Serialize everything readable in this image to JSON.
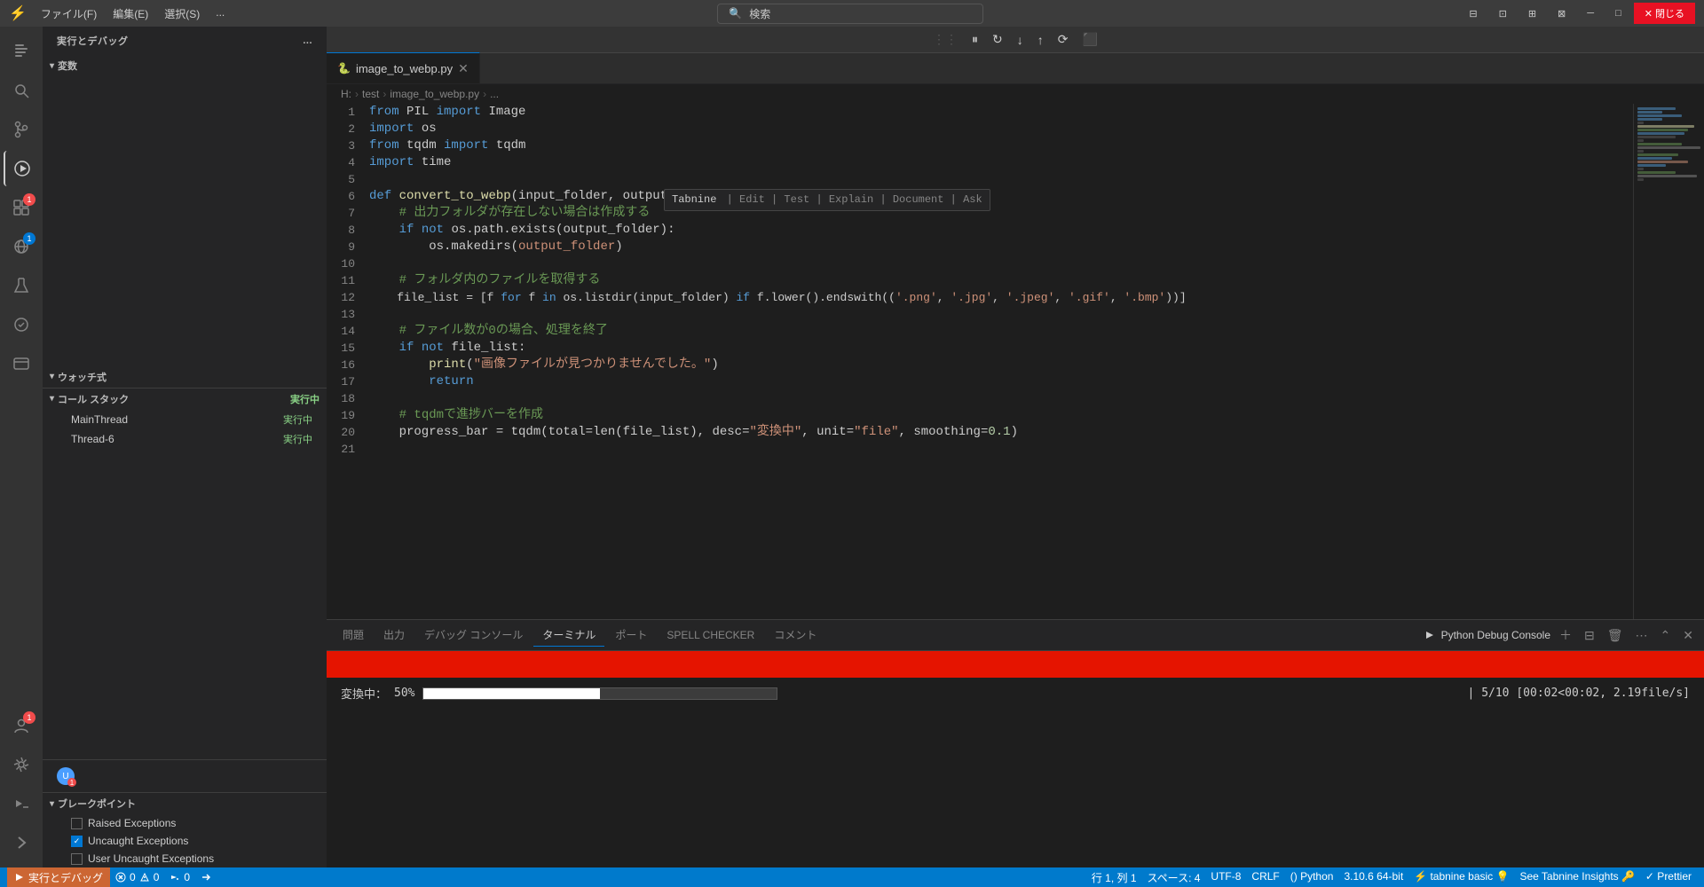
{
  "titleBar": {
    "logo": "VS",
    "menus": [
      "ファイル(F)",
      "編集(E)",
      "選択(S)",
      "..."
    ],
    "searchPlaceholder": "検索",
    "windowControls": [
      "─",
      "□",
      "✕"
    ]
  },
  "activityBar": {
    "icons": [
      {
        "name": "explorer-icon",
        "symbol": "⧉",
        "active": false
      },
      {
        "name": "search-icon",
        "symbol": "🔍",
        "active": false
      },
      {
        "name": "source-control-icon",
        "symbol": "⎇",
        "active": false
      },
      {
        "name": "run-debug-icon",
        "symbol": "▶",
        "active": true
      },
      {
        "name": "extensions-icon",
        "symbol": "⊞",
        "active": false,
        "badge": "1",
        "badgeType": "error"
      },
      {
        "name": "remote-explorer-icon",
        "symbol": "⬡",
        "active": false,
        "badge": "1"
      },
      {
        "name": "testing-icon",
        "symbol": "⚗",
        "active": false
      },
      {
        "name": "copilot-icon",
        "symbol": "✓",
        "active": false
      },
      {
        "name": "extensions2-icon",
        "symbol": "◫",
        "active": false
      }
    ],
    "bottomIcons": [
      {
        "name": "account-icon",
        "symbol": "👤",
        "badge": "1"
      },
      {
        "name": "settings-icon",
        "symbol": "⚙"
      },
      {
        "name": "debug-icon2",
        "symbol": "⚡"
      },
      {
        "name": "arrow-icon",
        "symbol": "→"
      }
    ]
  },
  "sidebar": {
    "header": "実行とデバッグ",
    "headerBtn": "...",
    "variablesSection": {
      "title": "変数",
      "collapsed": true
    },
    "watchSection": {
      "title": "ウォッチ式",
      "collapsed": true
    },
    "callStackSection": {
      "title": "コール スタック",
      "items": [
        {
          "name": "MainThread",
          "status": "実行中"
        },
        {
          "name": "Thread-6",
          "status": "実行中"
        }
      ]
    },
    "breakpointsSection": {
      "title": "ブレークポイント",
      "items": [
        {
          "label": "Raised Exceptions",
          "checked": false
        },
        {
          "label": "Uncaught Exceptions",
          "checked": true
        },
        {
          "label": "User Uncaught Exceptions",
          "checked": false
        }
      ]
    }
  },
  "editor": {
    "tab": {
      "filename": "image_to_webp.py",
      "icon": "🐍",
      "modified": false
    },
    "breadcrumb": [
      "H:",
      "test",
      "image_to_webp.py",
      "..."
    ],
    "lines": [
      {
        "num": 1,
        "code": "from PIL import Image",
        "tokens": [
          {
            "t": "kw",
            "v": "from"
          },
          {
            "t": "op",
            "v": " PIL "
          },
          {
            "t": "kw",
            "v": "import"
          },
          {
            "t": "op",
            "v": " Image"
          }
        ]
      },
      {
        "num": 2,
        "code": "import os",
        "tokens": [
          {
            "t": "kw",
            "v": "import"
          },
          {
            "t": "op",
            "v": " os"
          }
        ]
      },
      {
        "num": 3,
        "code": "from tqdm import tqdm",
        "tokens": [
          {
            "t": "kw",
            "v": "from"
          },
          {
            "t": "op",
            "v": " tqdm "
          },
          {
            "t": "kw",
            "v": "import"
          },
          {
            "t": "op",
            "v": " tqdm"
          }
        ]
      },
      {
        "num": 4,
        "code": "import time",
        "tokens": [
          {
            "t": "kw",
            "v": "import"
          },
          {
            "t": "op",
            "v": " time"
          }
        ]
      },
      {
        "num": 5,
        "code": "",
        "tokens": []
      },
      {
        "num": 6,
        "code": "def convert_to_webp(input_folder, output_folder):",
        "tokens": [
          {
            "t": "kw",
            "v": "def"
          },
          {
            "t": "op",
            "v": " "
          },
          {
            "t": "fn",
            "v": "convert_to_webp"
          },
          {
            "t": "op",
            "v": "(input_folder, output_folder):"
          }
        ]
      },
      {
        "num": 7,
        "code": "    # 出力フォルダが存在しない場合は作成する",
        "tokens": [
          {
            "t": "cm",
            "v": "    # 出力フォルダが存在しない場合は作成する"
          }
        ]
      },
      {
        "num": 8,
        "code": "    if not os.path.exists(output_folder):",
        "tokens": [
          {
            "t": "op",
            "v": "    "
          },
          {
            "t": "kw",
            "v": "if"
          },
          {
            "t": "op",
            "v": " "
          },
          {
            "t": "kw",
            "v": "not"
          },
          {
            "t": "op",
            "v": " os.path.exists(output_folder):"
          }
        ]
      },
      {
        "num": 9,
        "code": "        os.makedirs(output_folder)",
        "tokens": [
          {
            "t": "op",
            "v": "        os.makedirs(output_folder)"
          }
        ]
      },
      {
        "num": 10,
        "code": "",
        "tokens": []
      },
      {
        "num": 11,
        "code": "    # フォルダ内のファイルを取得する",
        "tokens": [
          {
            "t": "cm",
            "v": "    # フォルダ内のファイルを取得する"
          }
        ]
      },
      {
        "num": 12,
        "code": "    file_list = [f for f in os.listdir(input_folder) if f.lower().endswith(('.png', '.jpg', '.jpeg', '.gif', '.bmp'))]",
        "tokens": [
          {
            "t": "op",
            "v": "    file_list = [f "
          },
          {
            "t": "kw",
            "v": "for"
          },
          {
            "t": "op",
            "v": " f "
          },
          {
            "t": "kw",
            "v": "in"
          },
          {
            "t": "op",
            "v": " os.listdir(input_folder) "
          },
          {
            "t": "kw",
            "v": "if"
          },
          {
            "t": "op",
            "v": " f.lower().endswith(("
          },
          {
            "t": "str",
            "v": "'.png'"
          },
          {
            "t": "op",
            "v": ", "
          },
          {
            "t": "str",
            "v": "'.jpg'"
          },
          {
            "t": "op",
            "v": ", "
          },
          {
            "t": "str",
            "v": "'.jpeg'"
          },
          {
            "t": "op",
            "v": ", "
          },
          {
            "t": "str",
            "v": "'.gif'"
          },
          {
            "t": "op",
            "v": ", "
          },
          {
            "t": "str",
            "v": "'.bmp'"
          },
          {
            "t": "op",
            "v": "))]​"
          }
        ]
      },
      {
        "num": 13,
        "code": "",
        "tokens": []
      },
      {
        "num": 14,
        "code": "    # ファイル数が0の場合、処理を終了",
        "tokens": [
          {
            "t": "cm",
            "v": "    # ファイル数が0の場合、処理を終了"
          }
        ]
      },
      {
        "num": 15,
        "code": "    if not file_list:",
        "tokens": [
          {
            "t": "op",
            "v": "    "
          },
          {
            "t": "kw",
            "v": "if"
          },
          {
            "t": "op",
            "v": " "
          },
          {
            "t": "kw",
            "v": "not"
          },
          {
            "t": "op",
            "v": " file_list:"
          }
        ]
      },
      {
        "num": 16,
        "code": "        print(\"画像ファイルが見つかりませんでした。\")",
        "tokens": [
          {
            "t": "op",
            "v": "        "
          },
          {
            "t": "fn",
            "v": "print"
          },
          {
            "t": "op",
            "v": "("
          },
          {
            "t": "str",
            "v": "\"画像ファイルが見つかりませんでした。\""
          },
          {
            "t": "op",
            "v": ")"
          }
        ]
      },
      {
        "num": 17,
        "code": "        return",
        "tokens": [
          {
            "t": "op",
            "v": "        "
          },
          {
            "t": "kw",
            "v": "return"
          }
        ]
      },
      {
        "num": 18,
        "code": "",
        "tokens": []
      },
      {
        "num": 19,
        "code": "    # tqdmで進捗バーを作成",
        "tokens": [
          {
            "t": "cm",
            "v": "    # tqdmで進捗バーを作成"
          }
        ]
      },
      {
        "num": 20,
        "code": "    progress_bar = tqdm(total=len(file_list), desc=\"変換中\", unit=\"file\", smoothing=0.1)",
        "tokens": [
          {
            "t": "op",
            "v": "    progress_bar = tqdm(total=len(file_list), desc="
          },
          {
            "t": "str",
            "v": "\"変換中\""
          },
          {
            "t": "op",
            "v": ", unit="
          },
          {
            "t": "str",
            "v": "\"file\""
          },
          {
            "t": "op",
            "v": ", smoothing="
          },
          {
            "t": "num",
            "v": "0.1"
          },
          {
            "t": "op",
            "v": ")"
          }
        ]
      },
      {
        "num": 21,
        "code": "",
        "tokens": []
      }
    ],
    "tabnine": {
      "label": "Tabnine",
      "actions": [
        "Edit",
        "Test",
        "Explain",
        "Document",
        "Ask"
      ]
    }
  },
  "panel": {
    "tabs": [
      {
        "label": "問題",
        "active": false
      },
      {
        "label": "出力",
        "active": false
      },
      {
        "label": "デバッグ コンソール",
        "active": false
      },
      {
        "label": "ターミナル",
        "active": true
      },
      {
        "label": "ポート",
        "active": false
      },
      {
        "label": "SPELL CHECKER",
        "active": false
      },
      {
        "label": "コメント",
        "active": false
      }
    ],
    "pythonDebugConsole": "Python Debug Console",
    "terminal": {
      "progressLabel": "変換中：",
      "progressPercent": "50%",
      "progressStats": "| 5/10 [00:02<00:02,  2.19file/s]"
    }
  },
  "statusBar": {
    "left": [
      {
        "label": "⚡ 実行とデバッグ",
        "type": "debug"
      },
      {
        "icon": "⚠",
        "errors": "0",
        "warnings": "0"
      },
      {
        "icon": "⚡",
        "label": "0"
      },
      {
        "icon": "→",
        "label": ""
      }
    ],
    "right": [
      {
        "label": "行 1, 列 1"
      },
      {
        "label": "スペース: 4"
      },
      {
        "label": "UTF-8"
      },
      {
        "label": "CRLF"
      },
      {
        "label": "() Python"
      },
      {
        "label": "3.10.6 64-bit"
      },
      {
        "label": "⚡ tabnine basic 💡"
      },
      {
        "label": "See Tabnine Insights 🔑"
      },
      {
        "label": "✓ Prettier"
      }
    ]
  }
}
